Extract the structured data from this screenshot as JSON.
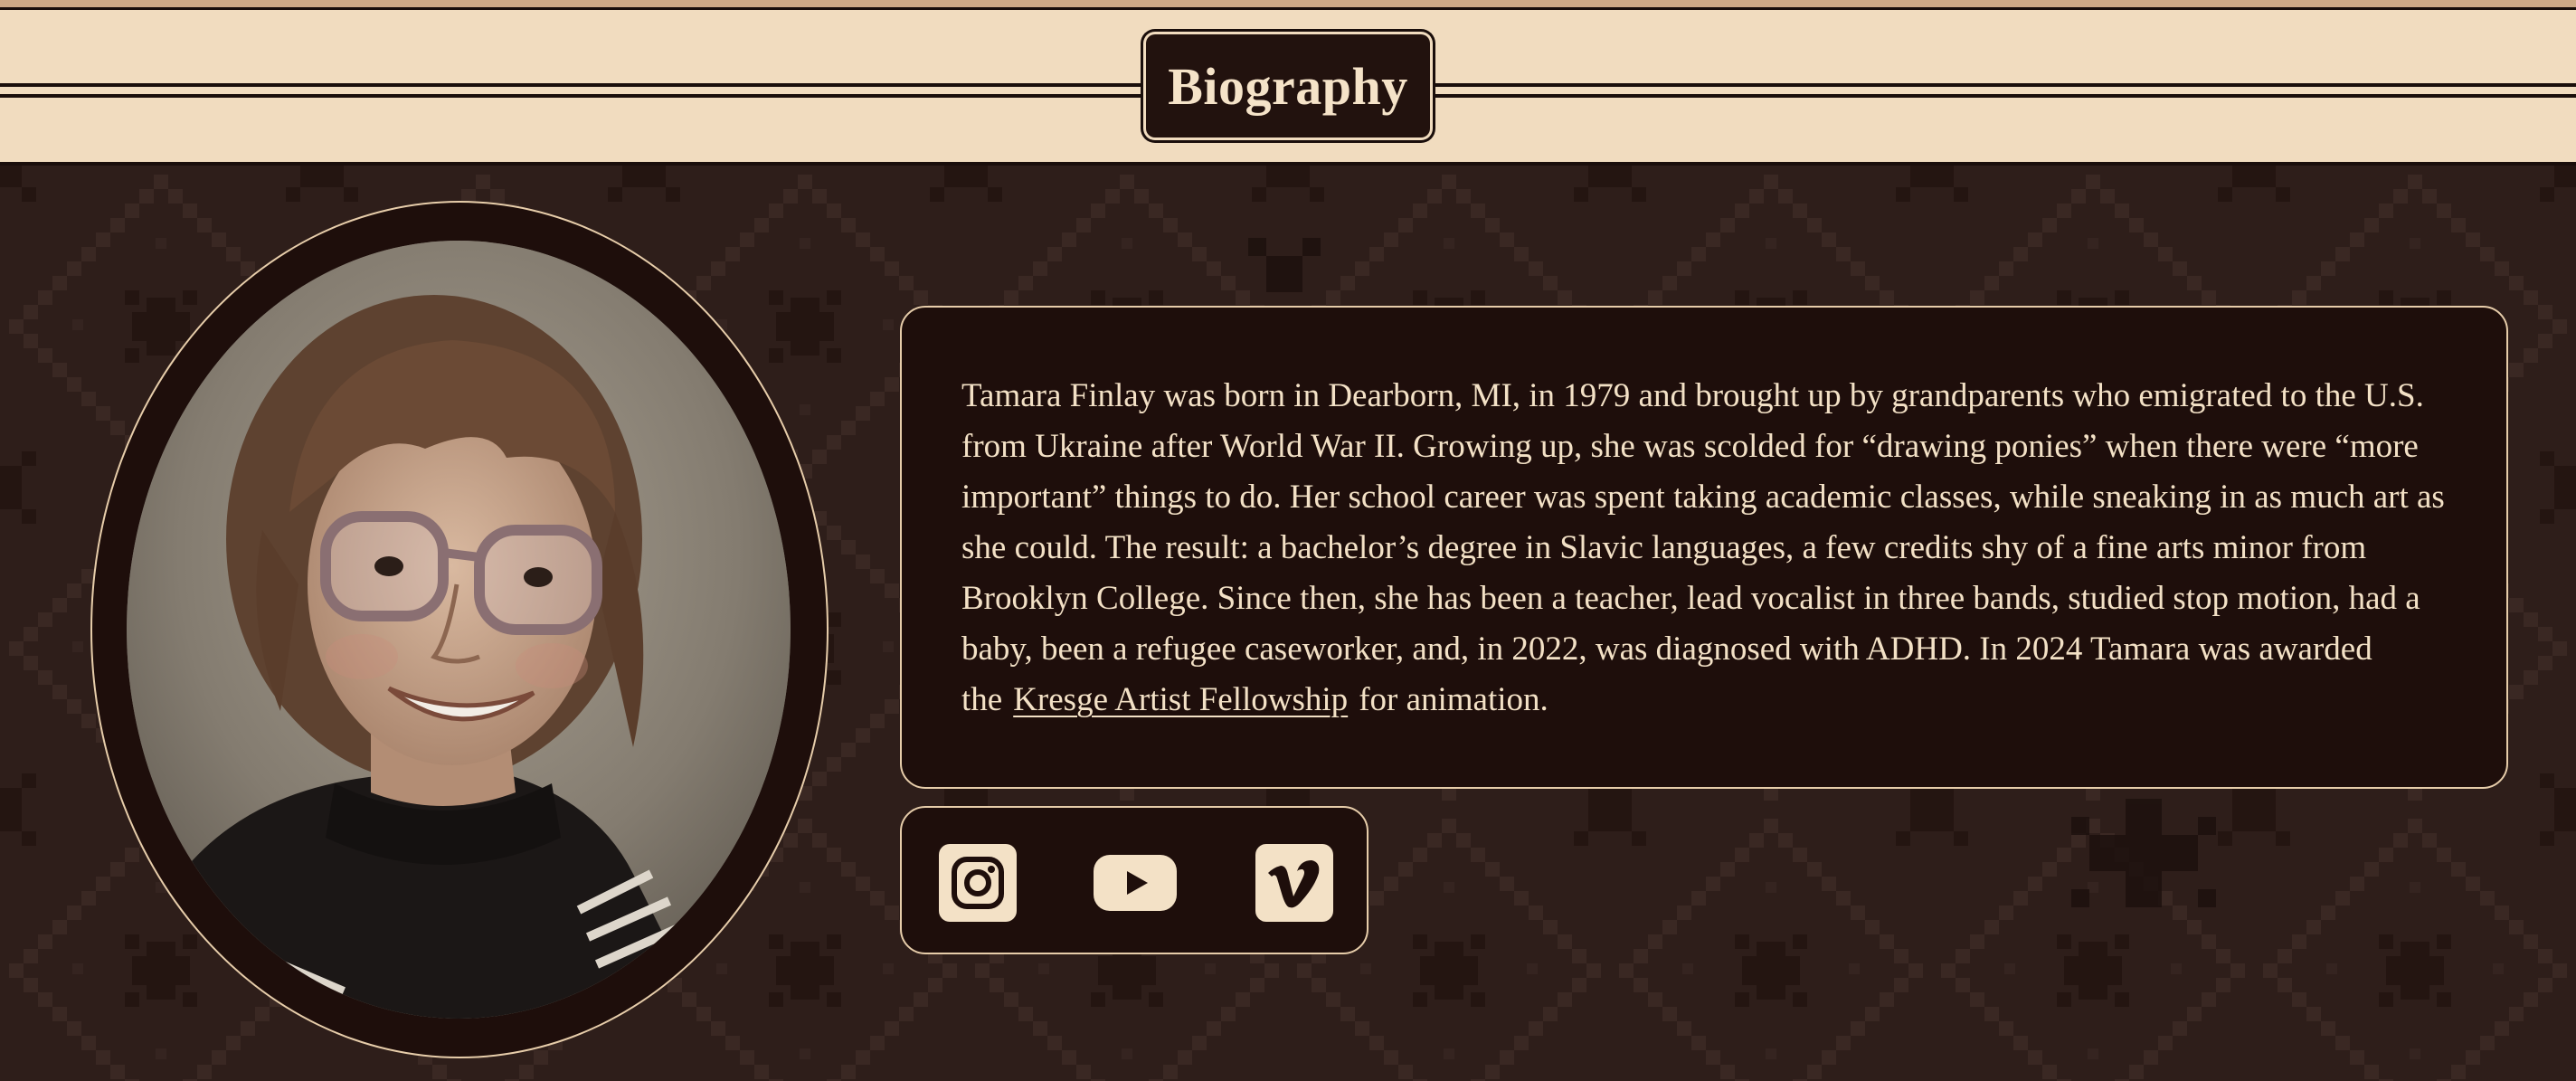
{
  "header": {
    "title": "Biography"
  },
  "portrait": {
    "alt": "Childhood portrait of Tamara Finlay"
  },
  "bio": {
    "text_before_link": "Tamara Finlay was born in Dearborn, MI, in 1979 and brought up by grandparents who emigrated to the U.S. from Ukraine after World War II. Growing up, she was scolded for “drawing ponies” when there were “more important” things to do. Her school career was spent taking academic classes, while sneaking in as much art as she could. The result: a bachelor’s degree in Slavic languages, a few credits shy of a fine arts minor from Brooklyn College. Since then, she has been a teacher, lead vocalist in three bands, studied stop motion, had a baby, been a refugee caseworker, and, in 2022, was diagnosed with ADHD. In 2024 Tamara was awarded the",
    "link_label": "Kresge Artist Fellowship",
    "text_after_link": "for animation."
  },
  "social": {
    "items": [
      {
        "name": "Instagram",
        "icon": "instagram-icon"
      },
      {
        "name": "YouTube",
        "icon": "youtube-icon"
      },
      {
        "name": "Vimeo",
        "icon": "vimeo-icon"
      }
    ]
  },
  "colors": {
    "header_band": "#f1dcbf",
    "card_background": "#1e0e0b",
    "card_border": "#e7cdaa",
    "text": "#f3e1c6",
    "pattern_background": "#2e1e1a"
  }
}
